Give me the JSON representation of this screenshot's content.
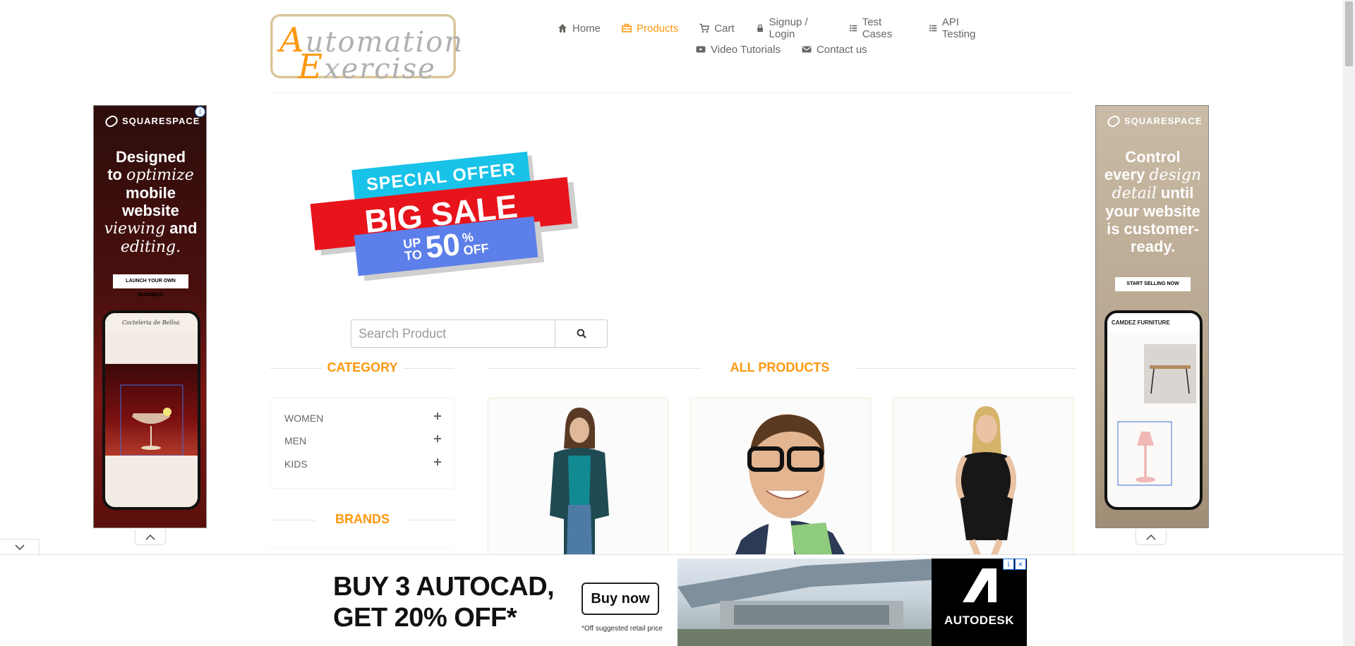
{
  "logo": {
    "line1_cap": "A",
    "line1_rest": "utomation",
    "line2_cap": "E",
    "line2_rest": "xercise"
  },
  "nav": {
    "items": [
      {
        "label": "Home",
        "icon": "home-icon"
      },
      {
        "label": "Products",
        "icon": "products-icon",
        "active": true
      },
      {
        "label": "Cart",
        "icon": "cart-icon"
      },
      {
        "label": "Signup / Login",
        "icon": "lock-icon"
      },
      {
        "label": "Test Cases",
        "icon": "list-icon"
      },
      {
        "label": "API Testing",
        "icon": "list-icon"
      },
      {
        "label": "Video Tutorials",
        "icon": "youtube-icon"
      },
      {
        "label": "Contact us",
        "icon": "envelope-icon"
      }
    ]
  },
  "colors": {
    "accent": "#fe980f",
    "text": "#696763",
    "sale_red": "#e8141b",
    "sale_cyan": "#18c2e8",
    "sale_blue": "#5d7fea"
  },
  "left_ad": {
    "brand": "SQUARESPACE",
    "copy": [
      "Designed",
      "to",
      "optimize",
      "mobile",
      "website",
      "viewing",
      "and",
      "editing."
    ],
    "cta": "LAUNCH YOUR OWN BUSINESS",
    "phone_title": "Cocteleria de Bellsa"
  },
  "right_ad": {
    "brand": "SQUARESPACE",
    "copy": [
      "Control",
      "every",
      "design",
      "detail",
      "until",
      "your website",
      "is customer-",
      "ready."
    ],
    "cta": "START SELLING NOW",
    "phone_title": "CAMDEZ FURNITURE"
  },
  "sale_banner": {
    "line1": "SPECIAL OFFER",
    "line2": "BIG SALE",
    "up": "UP",
    "to": "TO",
    "percent": "50",
    "pct_sign": "%",
    "off": "OFF"
  },
  "search": {
    "placeholder": "Search Product"
  },
  "category": {
    "title": "CATEGORY",
    "items": [
      {
        "label": "WOMEN"
      },
      {
        "label": "MEN"
      },
      {
        "label": "KIDS"
      }
    ]
  },
  "brands": {
    "title": "BRANDS"
  },
  "all_products": {
    "title": "ALL PRODUCTS"
  },
  "bottom_ad": {
    "line1": "BUY 3 AUTOCAD,",
    "line2": "GET 20% OFF*",
    "button": "Buy now",
    "fine_print": "*Off suggested retail price",
    "brand": "AUTODESK"
  }
}
